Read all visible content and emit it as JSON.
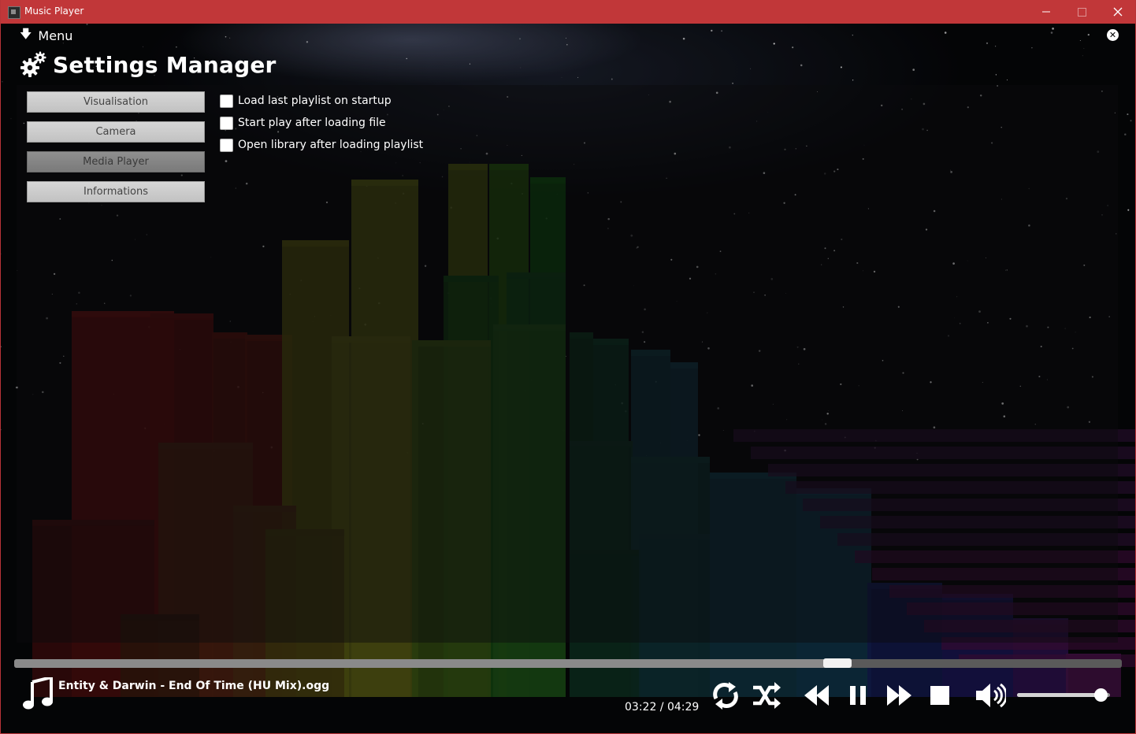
{
  "window": {
    "title": "Music Player",
    "accent_color": "#c13739"
  },
  "menu": {
    "label": "Menu",
    "icon": "arrow-down-icon"
  },
  "panel": {
    "title": "Settings Manager",
    "title_icon": "gears-icon",
    "close_icon": "close-circle-icon"
  },
  "tabs": [
    {
      "label": "Visualisation",
      "active": false
    },
    {
      "label": "Camera",
      "active": false
    },
    {
      "label": "Media Player",
      "active": true
    },
    {
      "label": "Informations",
      "active": false
    }
  ],
  "options": [
    {
      "label": "Load last playlist on startup",
      "checked": false
    },
    {
      "label": "Start play after loading file",
      "checked": false
    },
    {
      "label": "Open library after loading playlist",
      "checked": false
    }
  ],
  "player": {
    "track": "Entity & Darwin - End Of Time (HU Mix).ogg",
    "time": "03:22 / 04:29",
    "progress": 0.743,
    "volume": 0.9,
    "controls": [
      "repeat-icon",
      "shuffle-icon",
      "rewind-icon",
      "pause-icon",
      "fast-forward-icon",
      "stop-icon",
      "volume-icon"
    ]
  }
}
